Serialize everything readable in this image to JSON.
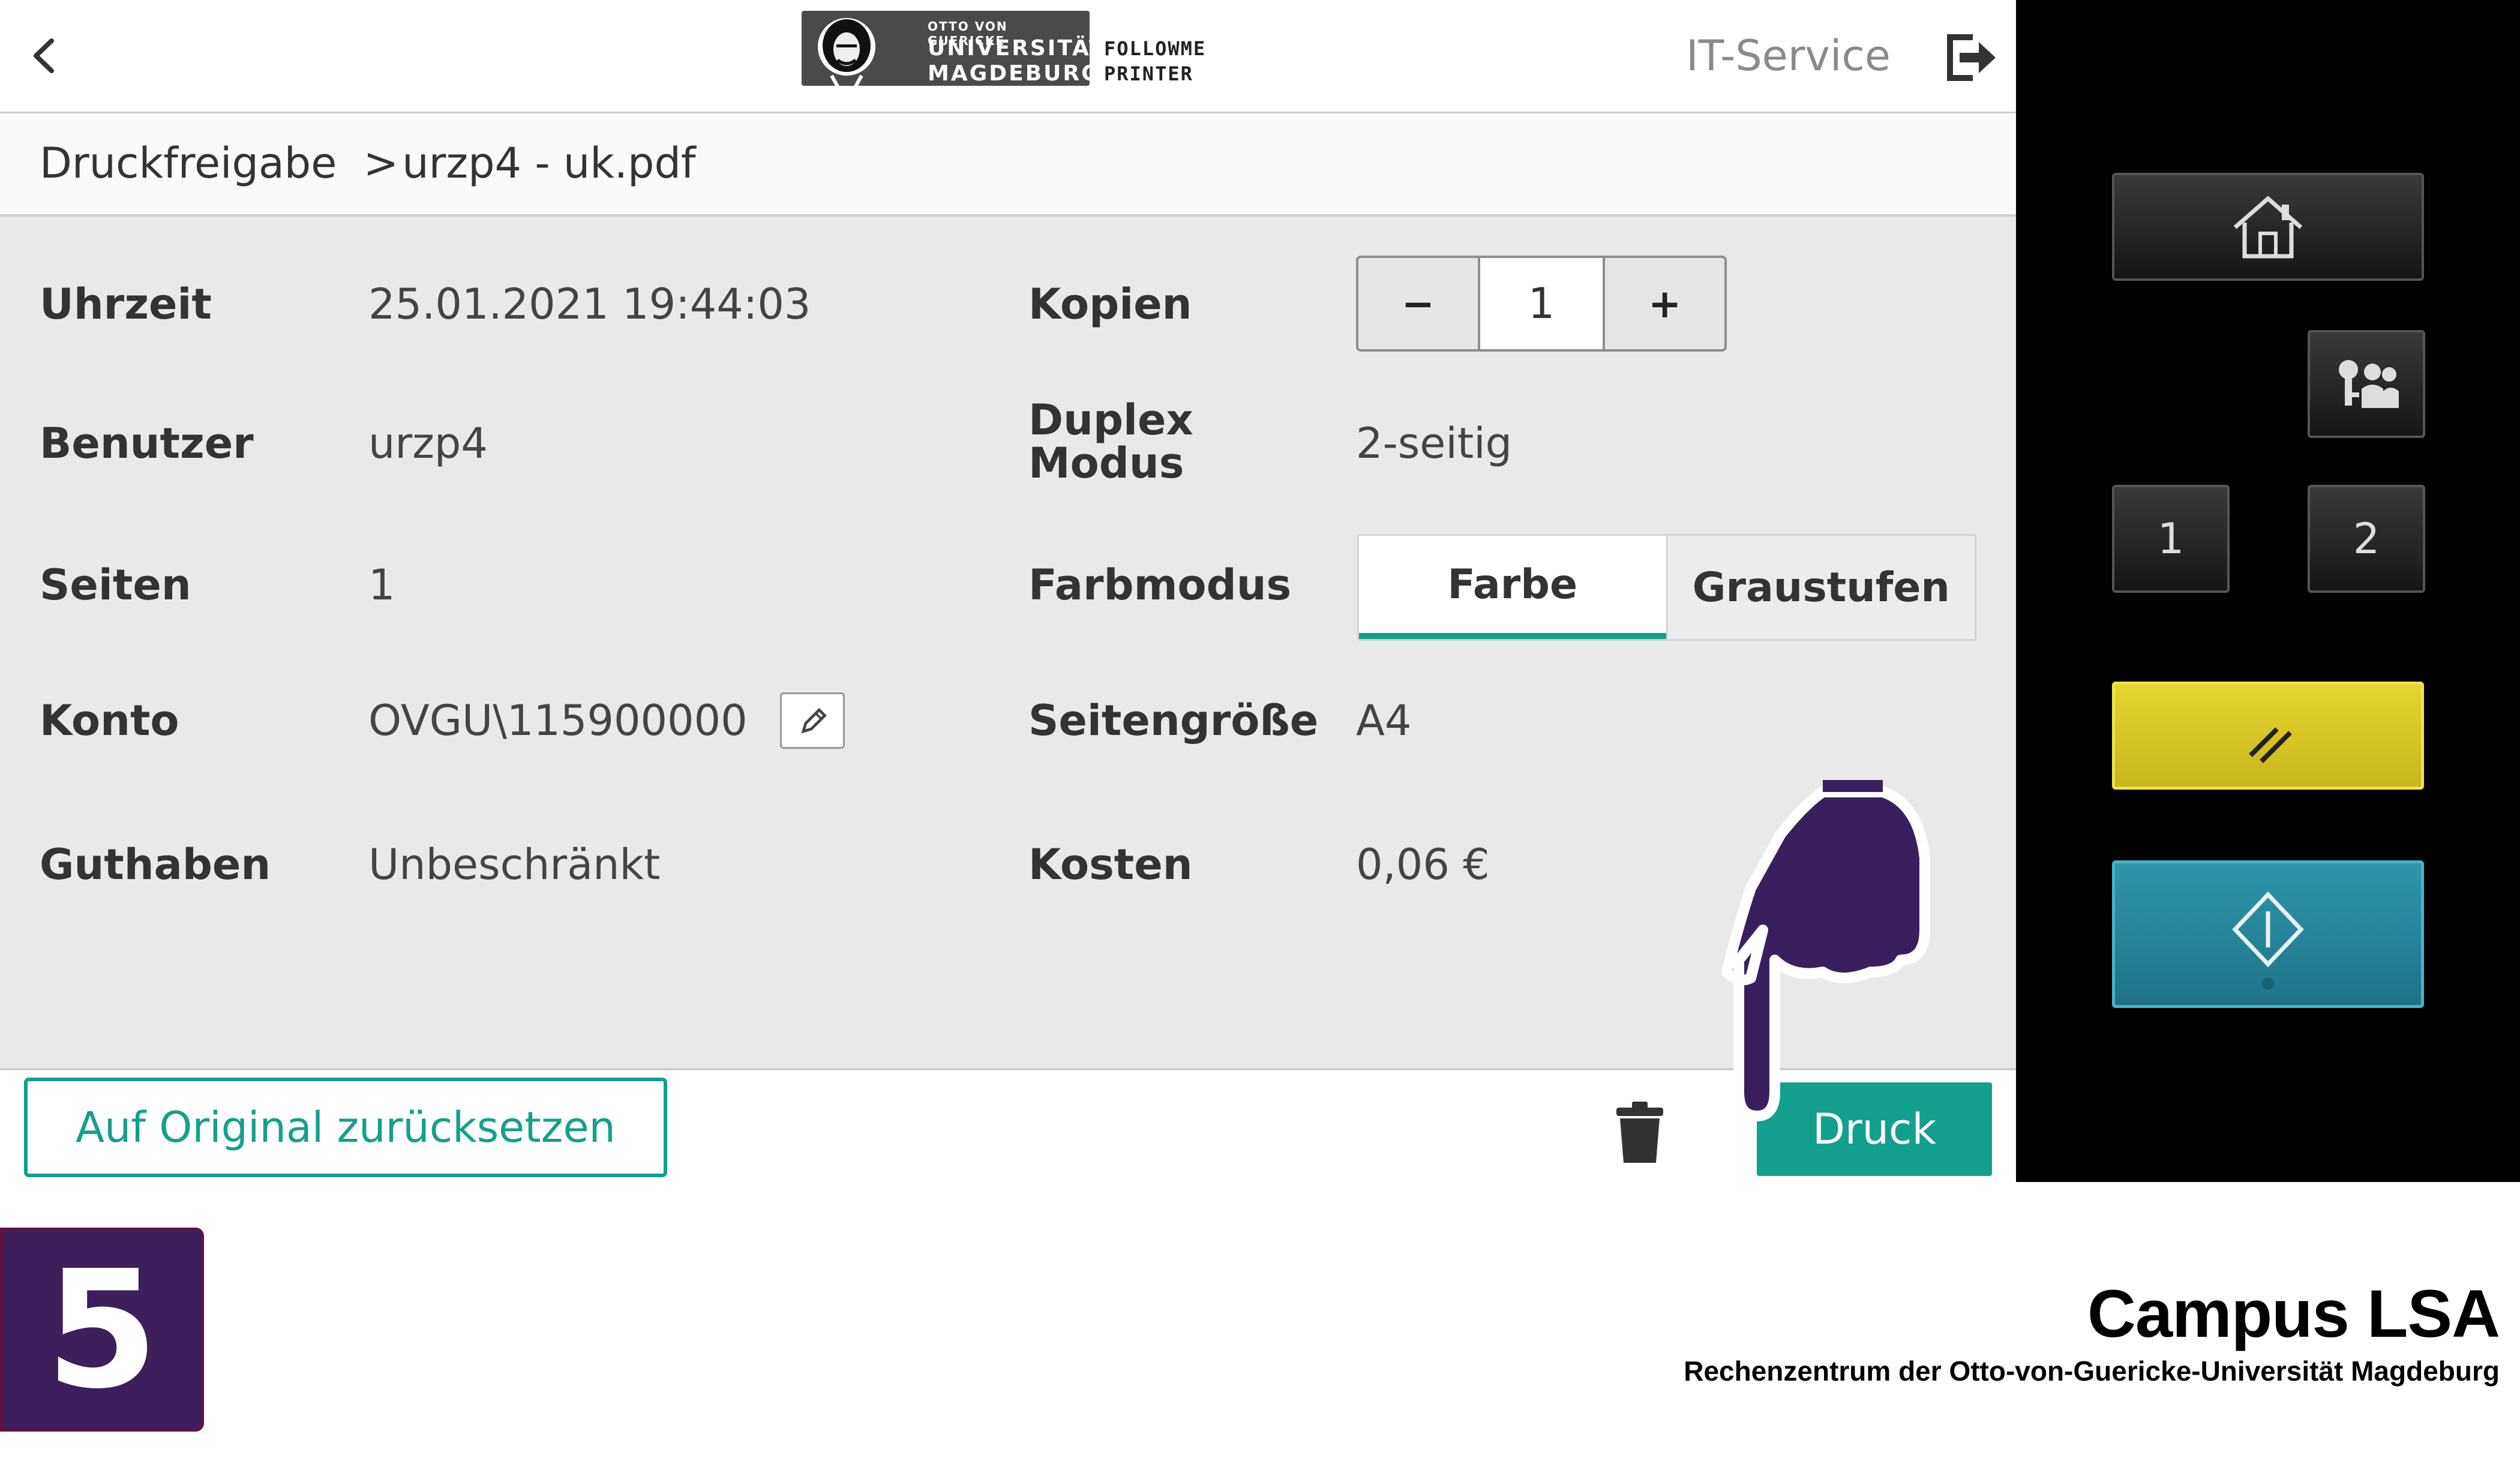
{
  "header": {
    "logo_line1": "OTTO VON GUERICKE",
    "logo_line2": "UNIVERSITÄT",
    "logo_line3": "MAGDEBURG",
    "app_line1": "FOLLOWME",
    "app_line2": "PRINTER",
    "it_service": "IT-Service"
  },
  "breadcrumb": {
    "root": "Druckfreigabe",
    "separator": ">",
    "current": "urzp4 - uk.pdf"
  },
  "left_fields": [
    {
      "label": "Uhrzeit",
      "value": "25.01.2021 19:44:03"
    },
    {
      "label": "Benutzer",
      "value": "urzp4"
    },
    {
      "label": "Seiten",
      "value": "1"
    },
    {
      "label": "Konto",
      "value": "OVGU\\115900000"
    },
    {
      "label": "Guthaben",
      "value": "Unbeschränkt"
    }
  ],
  "right_fields": {
    "copies_label": "Kopien",
    "copies_minus": "−",
    "copies_value": "1",
    "copies_plus": "+",
    "duplex_label_line1": "Duplex",
    "duplex_label_line2": "Modus",
    "duplex_value": "2-seitig",
    "color_label": "Farbmodus",
    "color_options": [
      "Farbe",
      "Graustufen"
    ],
    "color_selected": "Farbe",
    "size_label": "Seitengröße",
    "size_value": "A4",
    "cost_label": "Kosten",
    "cost_value": "0,06 €"
  },
  "actions": {
    "reset_label": "Auf Original zurücksetzen",
    "print_label": "Druck"
  },
  "hardware_panel": {
    "key1_label": "1",
    "key2_label": "2",
    "accent_yellow": "#e0cd2a",
    "accent_teal": "#2a8aa2"
  },
  "step": {
    "number": "5"
  },
  "brand": {
    "title": "Campus LSA",
    "subtitle": "Rechenzentrum der Otto-von-Guericke-Universität Magdeburg"
  },
  "colors": {
    "accent": "#13a08d",
    "badge": "#3d1f5c"
  }
}
